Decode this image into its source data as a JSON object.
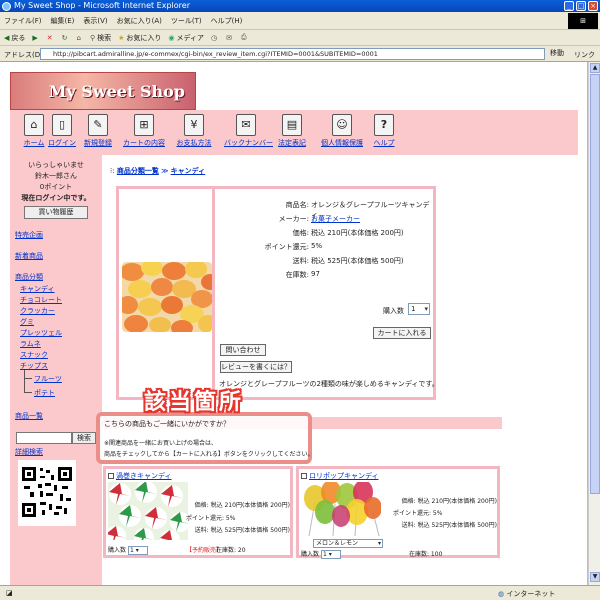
{
  "window": {
    "title": "My Sweet Shop - Microsoft Internet Explorer"
  },
  "menubar": [
    "ファイル(F)",
    "編集(E)",
    "表示(V)",
    "お気に入り(A)",
    "ツール(T)",
    "ヘルプ(H)"
  ],
  "toolbar": {
    "back": "戻る",
    "search": "検索",
    "favorites": "お気に入り",
    "media": "メディア"
  },
  "address": {
    "label": "アドレス(D)",
    "url": "http://pibcart.admiralline.jp/e-commex/cgi-bin/ex_review_item.cgi?ITEMID=0001&SUBITEMID=0001",
    "go": "移動",
    "links": "リンク"
  },
  "logo": "My Sweet Shop",
  "nav": [
    {
      "label": "ホーム",
      "icon": "home-icon",
      "glyph": "⌂"
    },
    {
      "label": "ログイン",
      "icon": "login-icon",
      "glyph": "▯"
    },
    {
      "label": "新規登録",
      "icon": "register-icon",
      "glyph": "✎"
    },
    {
      "label": "カートの内容",
      "icon": "cart-icon",
      "glyph": "⊞"
    },
    {
      "label": "お支払方法",
      "icon": "payment-icon",
      "glyph": "¥"
    },
    {
      "label": "バックナンバー",
      "icon": "magazine-icon",
      "glyph": "✉"
    },
    {
      "label": "法定表記",
      "icon": "document-icon",
      "glyph": "▤"
    },
    {
      "label": "個人情報保護",
      "icon": "person-icon",
      "glyph": "☺"
    },
    {
      "label": "ヘルプ",
      "icon": "help-icon",
      "glyph": "?"
    }
  ],
  "sidebar": {
    "welcome": [
      "いらっしゃいませ",
      "鈴木一郎さん",
      "0ポイント"
    ],
    "login_status": "現在ログイン中です。",
    "history_button": "買い物履歴",
    "links": [
      "特売企画",
      "新着商品",
      "商品分類"
    ],
    "categories": [
      "キャンディ",
      "チョコレート",
      "クラッカー",
      "グミ",
      "プレッツェル",
      "ラムネ",
      "スナック",
      "チップス"
    ],
    "subcategories": [
      "フルーツ",
      "ポテト"
    ],
    "list_link": "商品一覧",
    "search_button": "検索",
    "advanced_search": "詳細検索"
  },
  "breadcrumb": {
    "root": "商品分類一覧",
    "sep": "≫",
    "current": "キャンディ"
  },
  "product": {
    "labels": [
      "商品名:",
      "メーカー:",
      "価格:",
      "ポイント還元:",
      "送料:",
      "在庫数:"
    ],
    "name": "オレンジ＆グレープフルーツキャンディ",
    "maker": "お菓子メーカー",
    "price": "税込 210円(本体価格 200円)",
    "points": "5%",
    "shipping": "税込 525円(本体価格 500円)",
    "stock": "97",
    "qty_label": "購入数",
    "qty_value": "1",
    "cart_button": "カートに入れる",
    "inquiry_button": "問い合わせ",
    "review_button": "レビューを書くには？",
    "description": "オレンジとグレープフルーツの2種類の味が楽しめるキャンディです。"
  },
  "callout": "該当箇所",
  "cross_sell": {
    "title": "こちらの商品もご一緒にいかがですか？",
    "note_line1": "※関連商品を一緒にお買い上げの場合は、",
    "note_line2": "商品をチェックしてから【カートに入れる】ボタンをクリックしてください。",
    "items": [
      {
        "name": "渦巻きキャンディ",
        "price": "価格: 税込 210円(本体価格 200円)",
        "points": "ポイント還元: 5%",
        "shipping": "送料: 税込 525円(本体価格 500円)",
        "qty_label": "購入数",
        "qty_value": "1",
        "status": "【予約販売】",
        "stock": "在庫数: 20"
      },
      {
        "name": "ロリポップキャンディ",
        "price": "価格: 税込 210円(本体価格 200円)",
        "points": "ポイント還元: 5%",
        "shipping": "送料: 税込 525円(本体価格 500円)",
        "variant": "メロン＆レモン",
        "qty_label": "購入数",
        "qty_value": "1",
        "stock": "在庫数: 100"
      }
    ]
  },
  "status_bar": {
    "zone": "インターネット"
  }
}
